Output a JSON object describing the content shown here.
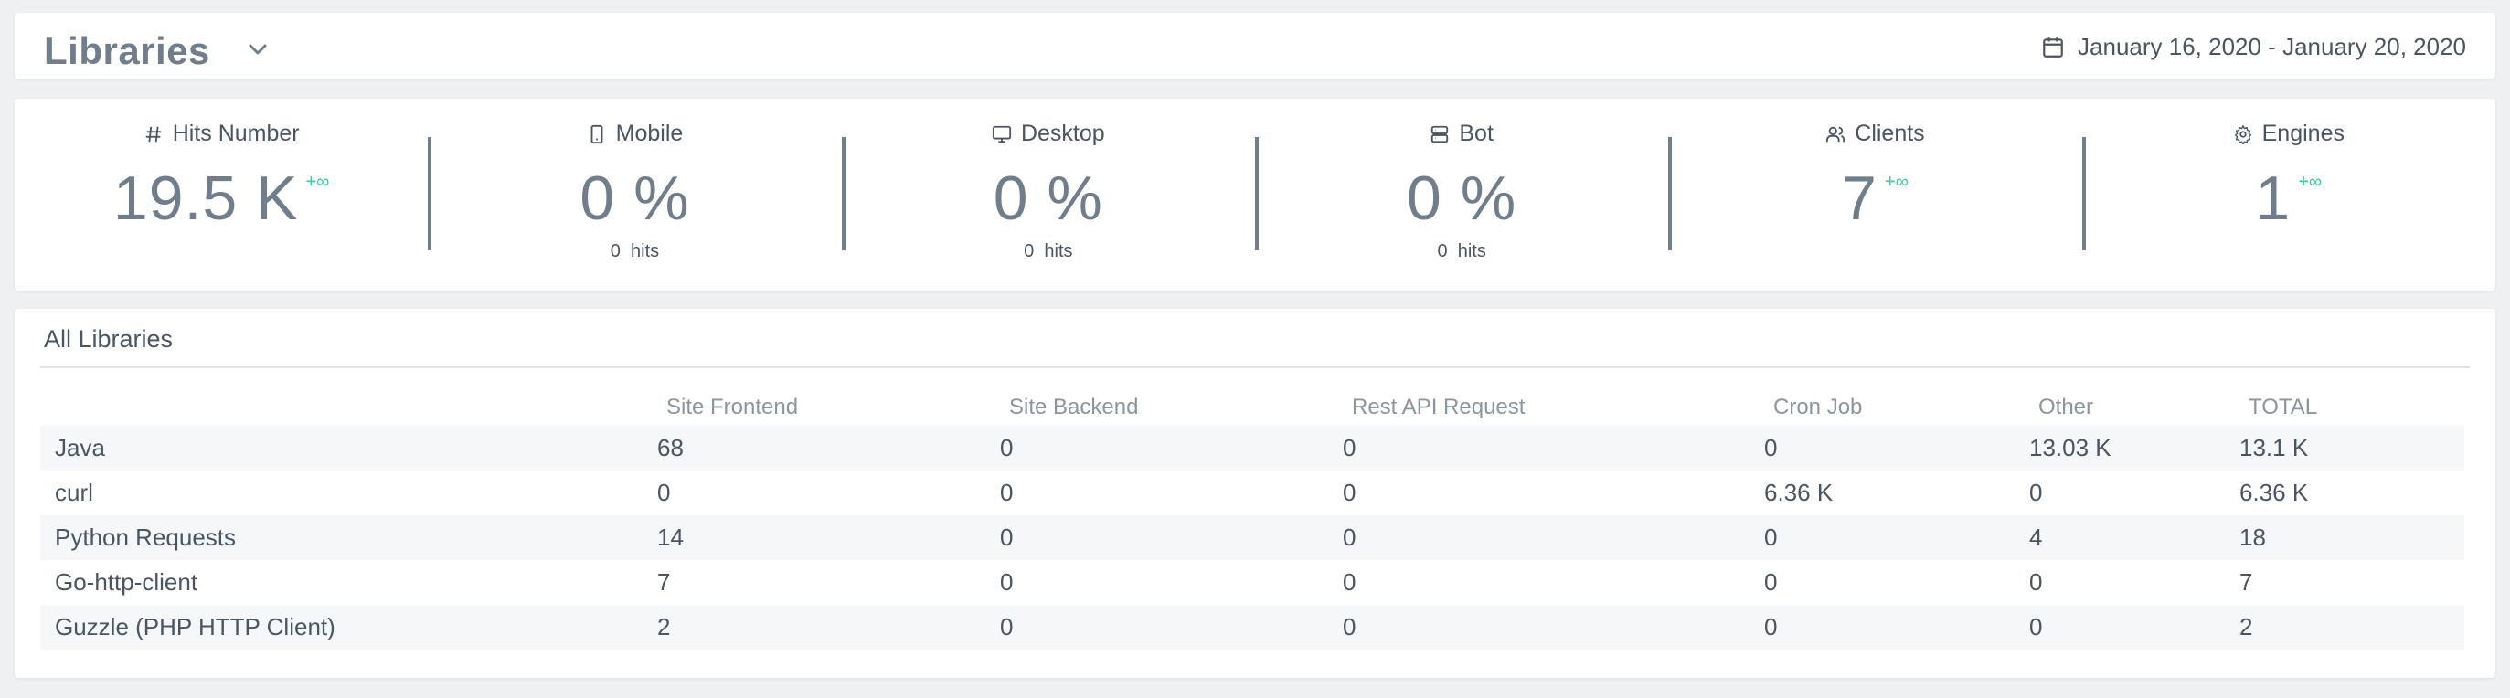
{
  "header": {
    "title": "Libraries",
    "date_range": "January 16, 2020 - January 20, 2020"
  },
  "stats": [
    {
      "icon": "hash-icon",
      "label": "Hits Number",
      "value": "19.5 K",
      "trend": "+∞",
      "sub_count": "",
      "sub_unit": ""
    },
    {
      "icon": "mobile-icon",
      "label": "Mobile",
      "value": "0 %",
      "trend": "",
      "sub_count": "0",
      "sub_unit": "hits"
    },
    {
      "icon": "desktop-icon",
      "label": "Desktop",
      "value": "0 %",
      "trend": "",
      "sub_count": "0",
      "sub_unit": "hits"
    },
    {
      "icon": "bot-icon",
      "label": "Bot",
      "value": "0 %",
      "trend": "",
      "sub_count": "0",
      "sub_unit": "hits"
    },
    {
      "icon": "users-icon",
      "label": "Clients",
      "value": "7",
      "trend": "+∞",
      "sub_count": "",
      "sub_unit": ""
    },
    {
      "icon": "gear-icon",
      "label": "Engines",
      "value": "1",
      "trend": "+∞",
      "sub_count": "",
      "sub_unit": ""
    }
  ],
  "libraries": {
    "title": "All Libraries",
    "columns": [
      "",
      "Site Frontend",
      "Site Backend",
      "Rest API Request",
      "Cron Job",
      "Other",
      "TOTAL"
    ],
    "rows": [
      [
        "Java",
        "68",
        "0",
        "0",
        "0",
        "13.03 K",
        "13.1 K"
      ],
      [
        "curl",
        "0",
        "0",
        "0",
        "6.36 K",
        "0",
        "6.36 K"
      ],
      [
        "Python Requests",
        "14",
        "0",
        "0",
        "0",
        "4",
        "18"
      ],
      [
        "Go-http-client",
        "7",
        "0",
        "0",
        "0",
        "0",
        "7"
      ],
      [
        "Guzzle (PHP HTTP Client)",
        "2",
        "0",
        "0",
        "0",
        "0",
        "2"
      ]
    ]
  },
  "colors": {
    "accent": "#6f7d8c",
    "trend": "#40c9a2",
    "text": "#4a5563",
    "background": "#eef0f2"
  }
}
